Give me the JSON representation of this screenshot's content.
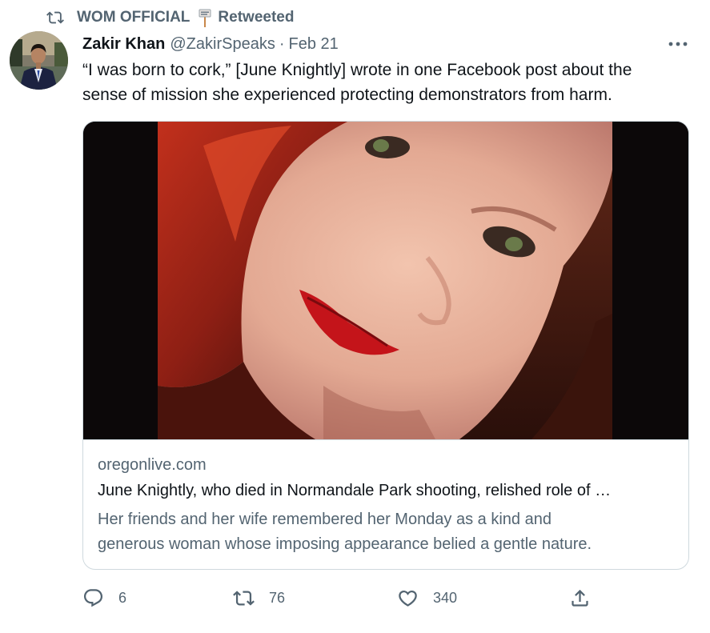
{
  "retweet_header": {
    "account": "WOM OFFICIAL",
    "label": "Retweeted"
  },
  "author": {
    "name": "Zakir Khan",
    "handle": "@ZakirSpeaks",
    "separator": "·",
    "date": "Feb 21"
  },
  "tweet": {
    "text_line1": "“I was born to cork,” [June Knightly] wrote in one Facebook post about the",
    "text_line2": "sense of mission she experienced protecting demonstrators from harm."
  },
  "card": {
    "domain": "oregonlive.com",
    "title": "June Knightly, who died in Normandale Park shooting, relished role of …",
    "description_line1": "Her friends and her wife remembered her Monday as a kind and",
    "description_line2": "generous woman whose imposing appearance belied a gentle nature."
  },
  "actions": {
    "replies": "6",
    "retweets": "76",
    "likes": "340"
  },
  "colors": {
    "text_primary": "#0f1419",
    "text_secondary": "#536471",
    "border": "#cfd9de"
  },
  "icons": {
    "retweeted": "retweet-icon",
    "more": "more-options-icon",
    "reply": "reply-icon",
    "retweet": "retweet-icon",
    "like": "heart-icon",
    "share": "share-icon"
  }
}
